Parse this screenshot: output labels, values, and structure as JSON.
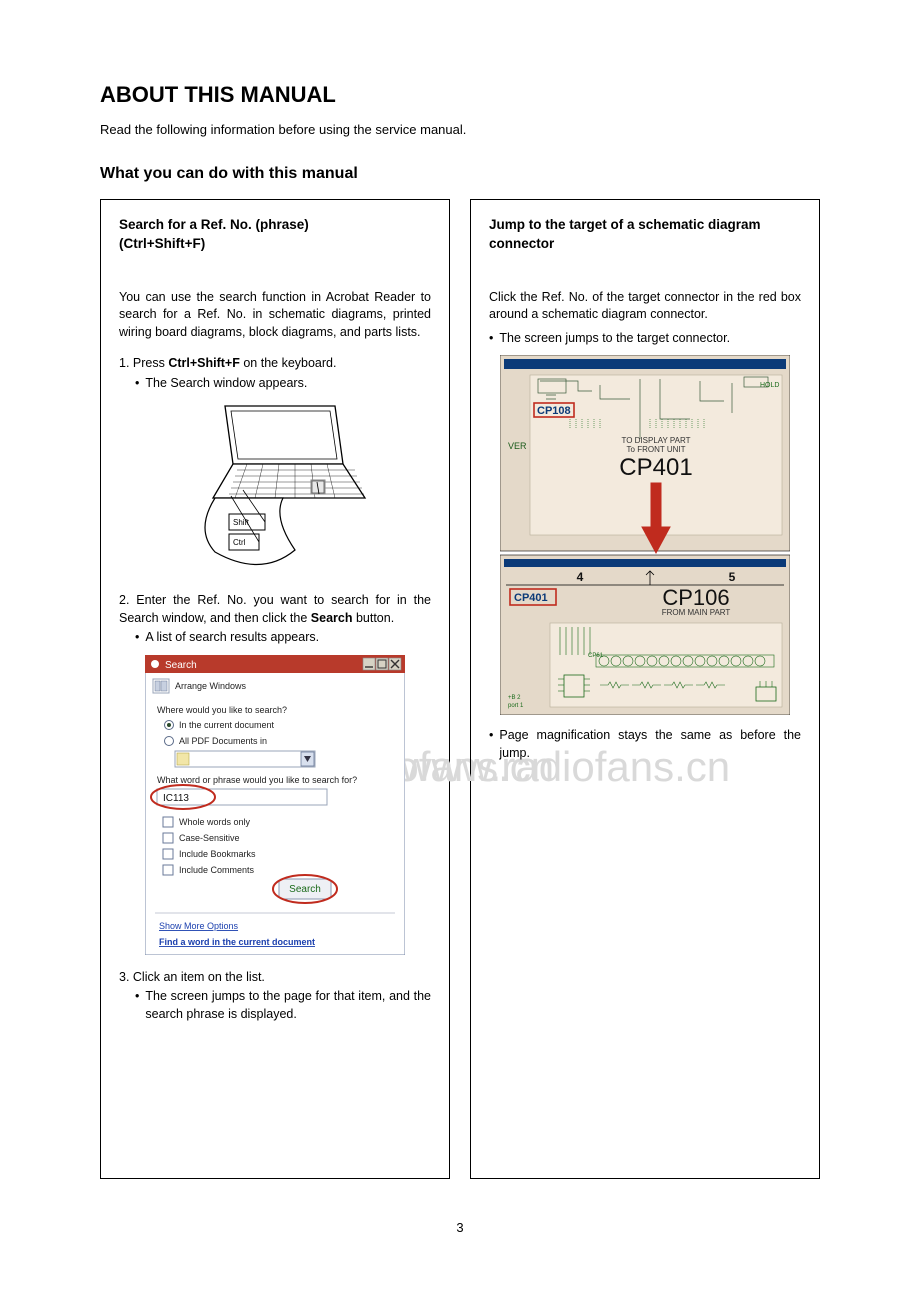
{
  "title": "ABOUT THIS MANUAL",
  "intro": "Read the following information before using the service manual.",
  "section_heading": "What you can do with this manual",
  "left": {
    "title_line1": "Search for a Ref. No. (phrase)",
    "title_line2": "(Ctrl+Shift+F)",
    "para1": "You can use the search function in Acrobat Reader to search for a Ref. No. in schematic diagrams, printed wiring board diagrams, block diagrams, and parts lists.",
    "step1_prefix": "1. Press ",
    "step1_keys": "Ctrl+Shift+F",
    "step1_suffix": " on the keyboard.",
    "step1_bullet": "The Search window appears.",
    "laptop": {
      "shift": "Shift",
      "ctrl": "Ctrl"
    },
    "step2_prefix": "2. Enter the Ref. No. you want to search for in the Search window, and then click the ",
    "step2_bold": "Search",
    "step2_suffix": " button.",
    "step2_bullet": "A list of search results appears.",
    "dialog": {
      "title": "Search",
      "arrange": "Arrange Windows",
      "q1": "Where would you like to search?",
      "opt_current": "In the current document",
      "opt_allpdf": "All PDF Documents in",
      "q2": "What word or phrase would you like to search for?",
      "input_value": "IC113",
      "cb_whole": "Whole words only",
      "cb_case": "Case-Sensitive",
      "cb_book": "Include Bookmarks",
      "cb_comm": "Include Comments",
      "btn_search": "Search",
      "link_more": "Show More Options",
      "link_find": "Find a word in the current document"
    },
    "step3_line": "3. Click an item on the list.",
    "step3_bullet": "The screen jumps to the page for that item, and the search phrase is displayed."
  },
  "right": {
    "title": "Jump to the target of a schematic diagram connector",
    "para1": "Click the Ref. No. of the target connector in the red box around a schematic diagram connector.",
    "bullet1": "The screen jumps to the target connector.",
    "schematic": {
      "cp108": "CP108",
      "ver": "VER",
      "line1": "TO DISPLAY PART",
      "line2": "To FRONT UNIT",
      "cp401_big": "CP401",
      "num4": "4",
      "num5": "5",
      "cp401_small": "CP401",
      "cp106": "CP106",
      "from_main": "FROM MAIN PART",
      "cp61": "CP61"
    },
    "bullet2": "Page magnification stays the same as before the jump."
  },
  "watermark": "www.radiofans.cn",
  "page_number": "3"
}
